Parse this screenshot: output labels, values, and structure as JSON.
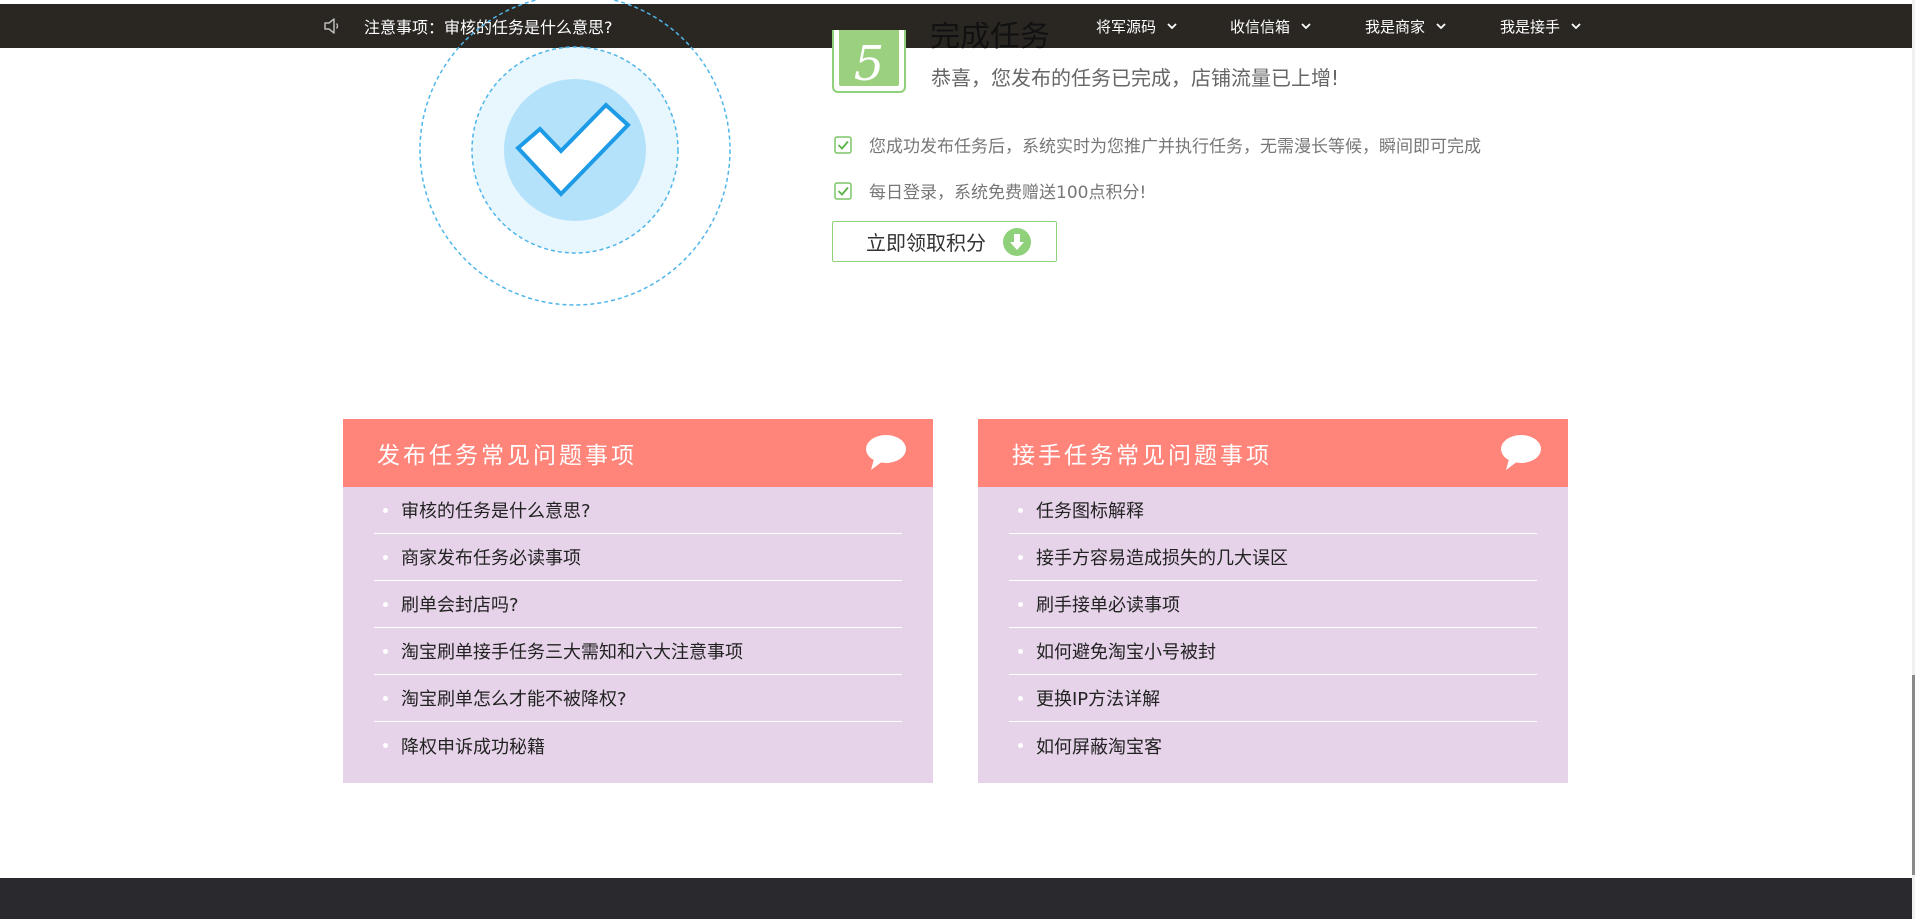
{
  "topbar": {
    "notice_text": "注意事项：审核的任务是什么意思?",
    "nav": [
      {
        "label": "将军源码"
      },
      {
        "label": "收信信箱"
      },
      {
        "label": "我是商家"
      },
      {
        "label": "我是接手"
      }
    ]
  },
  "step": {
    "badge_number": "5",
    "heading": "完成任务",
    "subtitle": "恭喜，您发布的任务已完成，店铺流量已上增!",
    "bullets": [
      "您成功发布任务后，系统实时为您推广并执行任务，无需漫长等候，瞬间即可完成",
      "每日登录，系统免费赠送100点积分!"
    ],
    "claim_button": "立即领取积分"
  },
  "faq_publish": {
    "title": "发布任务常见问题事项",
    "items": [
      "审核的任务是什么意思?",
      "商家发布任务必读事项",
      "刷单会封店吗?",
      "淘宝刷单接手任务三大需知和六大注意事项",
      "淘宝刷单怎么才能不被降权?",
      "降权申诉成功秘籍"
    ]
  },
  "faq_accept": {
    "title": "接手任务常见问题事项",
    "items": [
      "任务图标解释",
      "接手方容易造成损失的几大误区",
      "刷手接单必读事项",
      "如何避免淘宝小号被封",
      "更换IP方法详解",
      "如何屏蔽淘宝客"
    ]
  },
  "colors": {
    "topbar": "#2a2723",
    "accent_green": "#8ed17a",
    "faq_header": "#ff857b",
    "faq_body": "#e6d3e9",
    "check_blue": "#1e9be6",
    "footer": "#2a2a2e"
  }
}
